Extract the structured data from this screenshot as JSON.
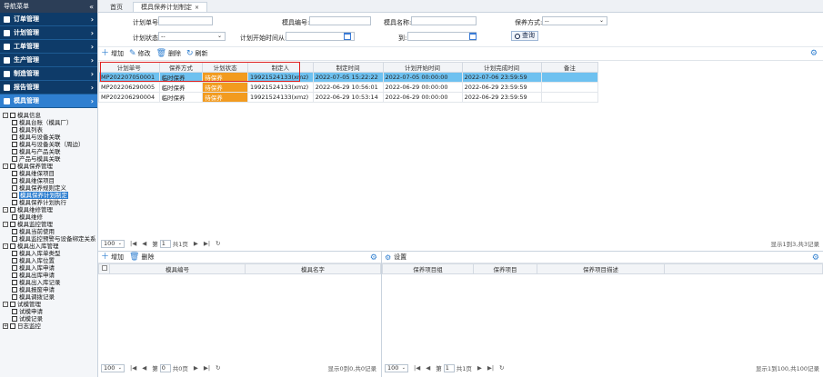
{
  "sidebar": {
    "title": "导航菜单",
    "collapse": "«",
    "menu": [
      {
        "label": "订单管理",
        "arrow": "›"
      },
      {
        "label": "计划管理",
        "arrow": "›"
      },
      {
        "label": "工单管理",
        "arrow": "›"
      },
      {
        "label": "生产管理",
        "arrow": "›"
      },
      {
        "label": "制造管理",
        "arrow": "›"
      },
      {
        "label": "报告管理",
        "arrow": "›"
      },
      {
        "label": "模具管理",
        "arrow": "›"
      }
    ],
    "tree": [
      {
        "label": "模具信息",
        "level": 0,
        "toggle": "-"
      },
      {
        "label": "模具台账（模具厂）",
        "level": 1
      },
      {
        "label": "模具列表",
        "level": 1
      },
      {
        "label": "模具与设备关联",
        "level": 1
      },
      {
        "label": "模具与设备关联（周边）",
        "level": 1
      },
      {
        "label": "模具与产品关联",
        "level": 1
      },
      {
        "label": "产品与模具关联",
        "level": 1
      },
      {
        "label": "模具保养管理",
        "level": 0,
        "toggle": "-"
      },
      {
        "label": "模具维保项目",
        "level": 1
      },
      {
        "label": "模具维保项目",
        "level": 1
      },
      {
        "label": "模具保养规则定义",
        "level": 1
      },
      {
        "label": "模具保养计划制定",
        "level": 1,
        "selected": true
      },
      {
        "label": "模具保养计划执行",
        "level": 1
      },
      {
        "label": "模具维修管理",
        "level": 0,
        "toggle": "-"
      },
      {
        "label": "模具维修",
        "level": 1
      },
      {
        "label": "模具监控管理",
        "level": 0,
        "toggle": "-"
      },
      {
        "label": "模具当前使用",
        "level": 1
      },
      {
        "label": "模具监控预警与设备绑定关系",
        "level": 1
      },
      {
        "label": "模具出入库管理",
        "level": 0,
        "toggle": "-"
      },
      {
        "label": "模具入库单类型",
        "level": 1
      },
      {
        "label": "模具入库位置",
        "level": 1
      },
      {
        "label": "模具入库申请",
        "level": 1
      },
      {
        "label": "模具出库申请",
        "level": 1
      },
      {
        "label": "模具出入库记录",
        "level": 1
      },
      {
        "label": "模具报废申请",
        "level": 1
      },
      {
        "label": "模具调拨记录",
        "level": 1
      },
      {
        "label": "试模管理",
        "level": 0,
        "toggle": "-"
      },
      {
        "label": "试模申请",
        "level": 1
      },
      {
        "label": "试模记录",
        "level": 1
      },
      {
        "label": "日志监控",
        "level": 0,
        "toggle": "+"
      }
    ]
  },
  "tabs": [
    {
      "label": "首页",
      "active": false
    },
    {
      "label": "模具保养计划制定",
      "active": true,
      "close": "×"
    }
  ],
  "filter": {
    "plan_no_label": "计划单号:",
    "mold_no_label": "模具编号:",
    "mold_name_label": "模具名称:",
    "maint_method_label": "保养方式:",
    "maint_method_value": "--",
    "plan_status_label": "计划状态:",
    "plan_status_value": "--",
    "plan_start_label": "计划开始时间从:",
    "to_label": "到:",
    "query_label": "查询"
  },
  "toolbar": {
    "add": "增加",
    "edit": "修改",
    "delete": "删除",
    "refresh": "刷新"
  },
  "grid": {
    "columns": [
      "计划单号",
      "保养方式",
      "计划状态",
      "制定人",
      "制定时间",
      "计划开始时间",
      "计划完成时间",
      "备注"
    ],
    "rows": [
      [
        "MP202207050001",
        "临时保养",
        "待保养",
        "19921524133(xmz)",
        "2022-07-05 15:22:22",
        "2022-07-05 00:00:00",
        "2022-07-06 23:59:59",
        ""
      ],
      [
        "MP202206290005",
        "临时保养",
        "待保养",
        "19921524133(xmz)",
        "2022-06-29 10:56:01",
        "2022-06-29 00:00:00",
        "2022-06-29 23:59:59",
        ""
      ],
      [
        "MP202206290004",
        "临时保养",
        "待保养",
        "19921524133(xmz)",
        "2022-06-29 10:53:14",
        "2022-06-29 00:00:00",
        "2022-06-29 23:59:59",
        ""
      ]
    ]
  },
  "pager_main": {
    "size": "100",
    "page_label": "第",
    "page": "1",
    "total_pages": "共1页",
    "info": "显示1到3,共3记录"
  },
  "left_panel": {
    "add": "增加",
    "delete": "删除",
    "columns": [
      "模具编号",
      "模具名字"
    ]
  },
  "right_panel": {
    "title": "设置",
    "columns": [
      "保养项目组",
      "保养项目",
      "保养项目描述"
    ]
  },
  "pager_left": {
    "size": "100",
    "page_label": "第",
    "page": "0",
    "total_pages": "共0页",
    "info": "显示0到0,共0记录"
  },
  "pager_right": {
    "size": "100",
    "page_label": "第",
    "page": "1",
    "total_pages": "共1页",
    "info": "显示1到100,共100记录"
  },
  "pager_icons": {
    "first": "|◀",
    "prev": "◀",
    "next": "▶",
    "last": "▶|",
    "reload": "↻"
  }
}
